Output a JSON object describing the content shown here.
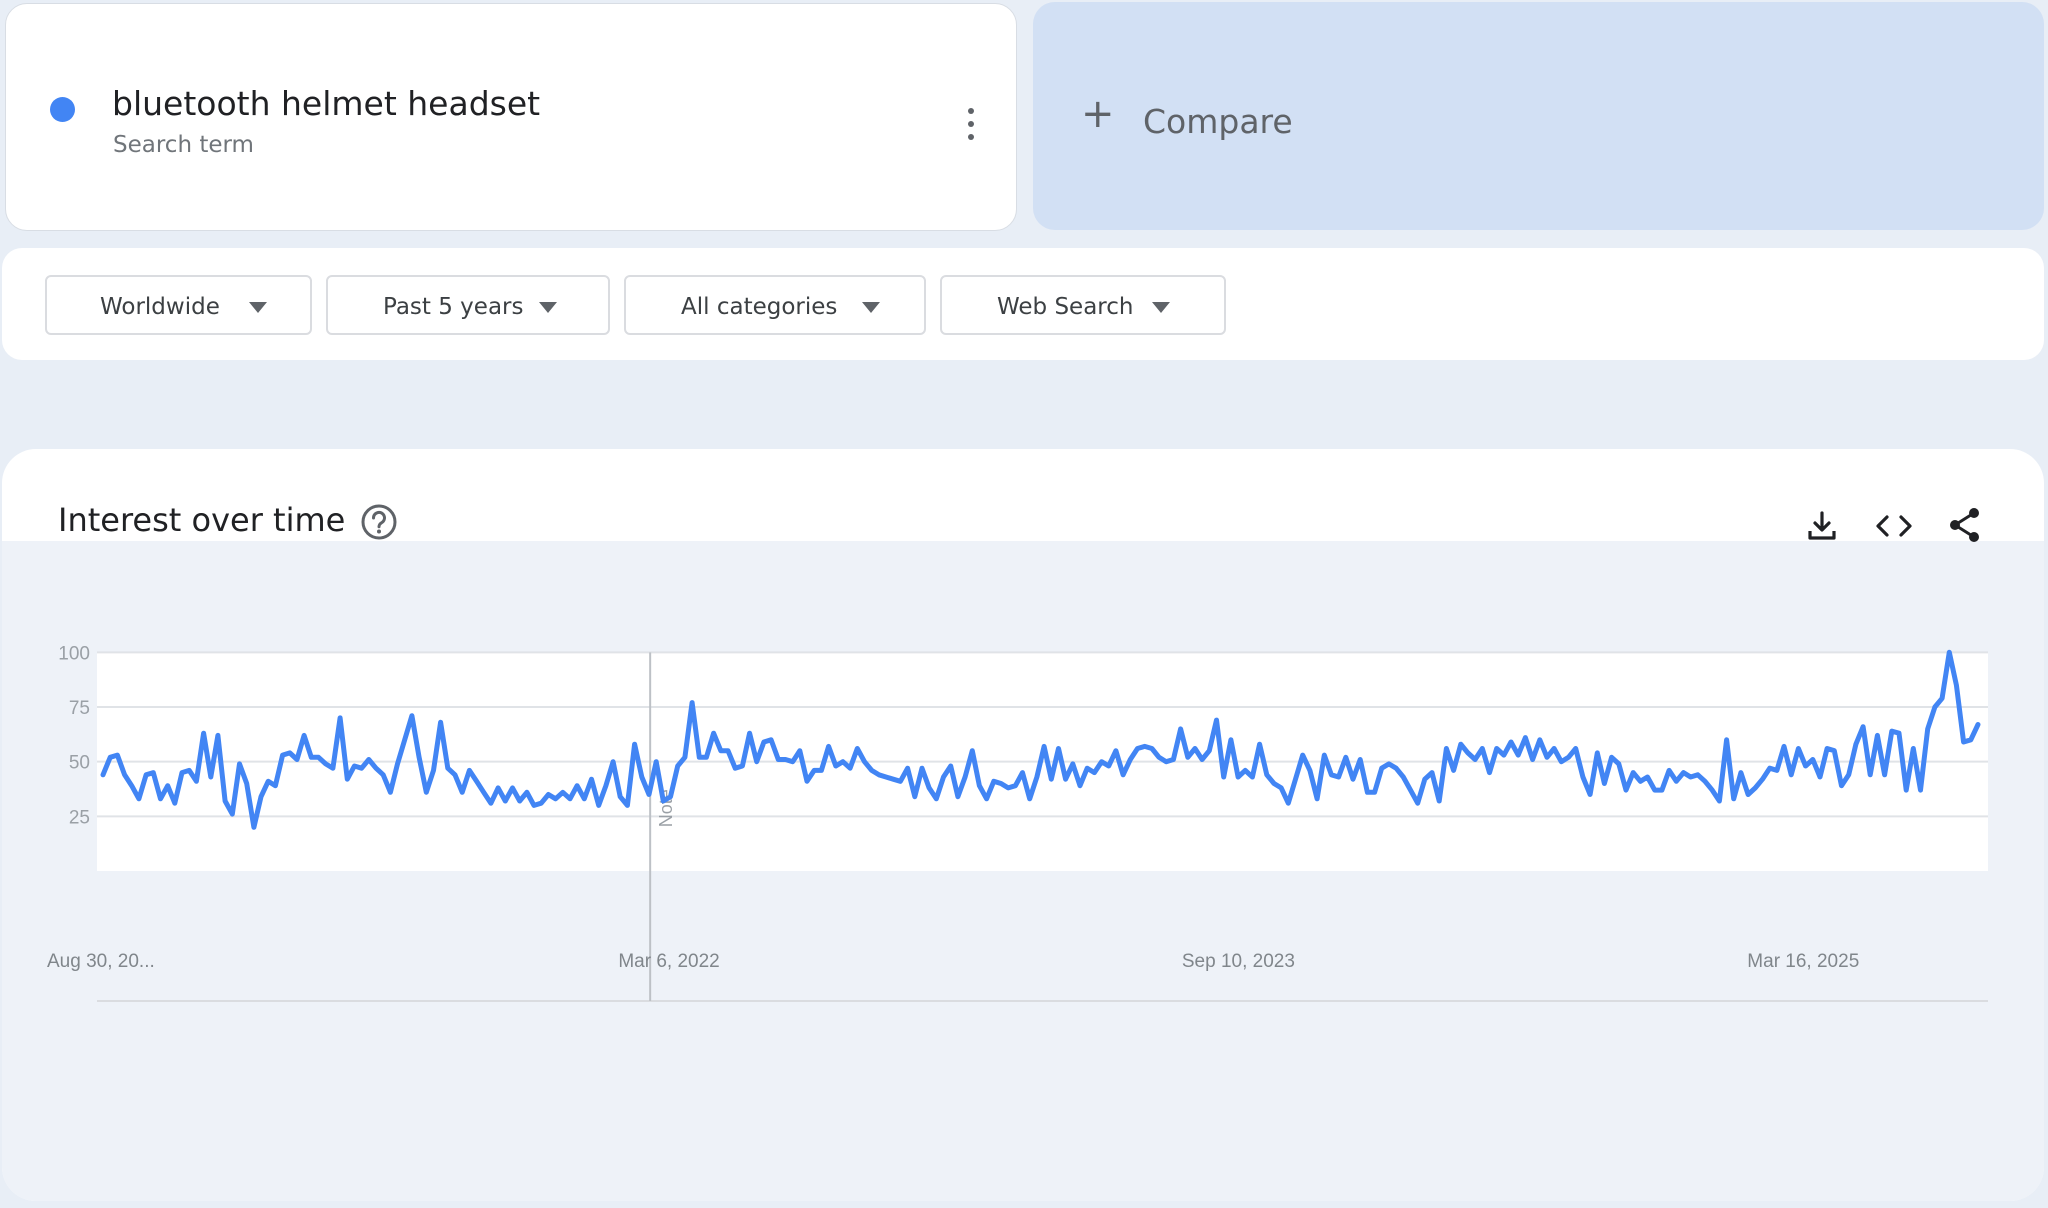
{
  "search_term": {
    "name": "bluetooth helmet headset",
    "subtitle": "Search term",
    "color": "#4285f4"
  },
  "compare": {
    "plus": "+",
    "label": "Compare"
  },
  "filters": {
    "region": "Worldwide",
    "time_range": "Past 5 years",
    "category": "All categories",
    "search_type": "Web Search"
  },
  "interest_over_time": {
    "title": "Interest over time",
    "icons": [
      "help-icon",
      "download-icon",
      "embed-icon",
      "share-icon"
    ]
  },
  "chart_data": {
    "type": "line",
    "line_color": "#4285f4",
    "ylim": [
      0,
      100
    ],
    "y_ticks": [
      "100",
      "75",
      "50",
      "25"
    ],
    "x_tick_labels": [
      "Aug 30, 20...",
      "Mar 6, 2022",
      "Sep 10, 2023",
      "Mar 16, 2025"
    ],
    "note_label": "Note",
    "grid": true,
    "series": [
      {
        "values": [
          44,
          52,
          53,
          44,
          39,
          33,
          44,
          45,
          33,
          39,
          31,
          45,
          46,
          41,
          63,
          43,
          62,
          32,
          26,
          49,
          40,
          20,
          34,
          41,
          39,
          53,
          54,
          51,
          62,
          52,
          52,
          49,
          47,
          70,
          42,
          48,
          47,
          51,
          47,
          44,
          36,
          49,
          60,
          71,
          52,
          36,
          46,
          68,
          47,
          44,
          36,
          46,
          41,
          36,
          31,
          38,
          32,
          38,
          32,
          36,
          30,
          31,
          35,
          33,
          36,
          33,
          39,
          33,
          42,
          30,
          39,
          50,
          34,
          30,
          58,
          43,
          35,
          50,
          32,
          34,
          48,
          52,
          77,
          52,
          52,
          63,
          55,
          55,
          47,
          48,
          63,
          50,
          59,
          60,
          51,
          51,
          50,
          55,
          41,
          46,
          46,
          57,
          48,
          50,
          47,
          56,
          50,
          46,
          44,
          43,
          42,
          41,
          47,
          34,
          47,
          38,
          33,
          43,
          48,
          34,
          43,
          55,
          39,
          33,
          41,
          40,
          38,
          39,
          45,
          33,
          43,
          57,
          42,
          56,
          42,
          49,
          39,
          47,
          45,
          50,
          48,
          55,
          44,
          51,
          56,
          57,
          56,
          52,
          50,
          51,
          65,
          52,
          56,
          51,
          55,
          69,
          43,
          60,
          43,
          46,
          43,
          58,
          44,
          40,
          38,
          31,
          42,
          53,
          46,
          33,
          53,
          44,
          43,
          52,
          42,
          51,
          36,
          36,
          47,
          49,
          47,
          43,
          37,
          31,
          42,
          45,
          32,
          56,
          46,
          58,
          54,
          51,
          56,
          45,
          56,
          53,
          59,
          53,
          61,
          51,
          60,
          52,
          56,
          50,
          52,
          56,
          43,
          35,
          54,
          40,
          52,
          49,
          37,
          45,
          41,
          43,
          37,
          37,
          46,
          41,
          45,
          43,
          44,
          41,
          37,
          32,
          60,
          33,
          45,
          35,
          38,
          42,
          47,
          46,
          57,
          44,
          56,
          48,
          51,
          43,
          56,
          55,
          39,
          44,
          58,
          66,
          44,
          62,
          44,
          64,
          63,
          37,
          56,
          37,
          65,
          75,
          79,
          100,
          85,
          59,
          60,
          67
        ]
      }
    ]
  }
}
